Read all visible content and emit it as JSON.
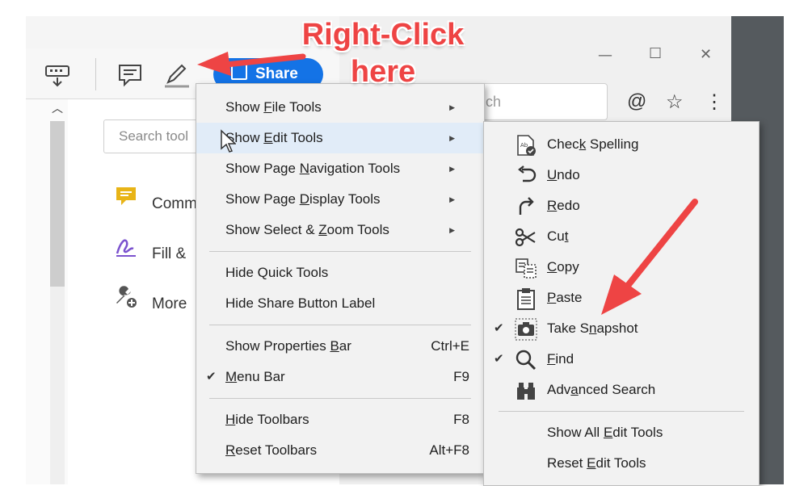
{
  "annotation": {
    "line1": "Right-Click",
    "line2": "here",
    "arrow_color": "#ee4444"
  },
  "share_button": {
    "label": "Share"
  },
  "browser": {
    "window_controls": {
      "minimize": "—",
      "maximize": "☐",
      "close": "✕"
    },
    "address_fragment": "ch",
    "icons": [
      "at-icon",
      "star-icon",
      "more-icon"
    ]
  },
  "tools_pane": {
    "search_placeholder": "Search tool",
    "items": [
      {
        "label": "Comm",
        "icon": "comment-icon",
        "color": "#e8b417"
      },
      {
        "label": "Fill &",
        "icon": "fill-sign-icon",
        "color": "#7b52ce"
      },
      {
        "label": "More",
        "icon": "wrench-plus-icon",
        "color": "#555555"
      }
    ]
  },
  "main_menu": {
    "items": [
      {
        "pre": "Show ",
        "key": "F",
        "post": "ile Tools",
        "submenu": true
      },
      {
        "pre": "Show ",
        "key": "E",
        "post": "dit Tools",
        "submenu": true,
        "highlighted": true
      },
      {
        "pre": "Show Page ",
        "key": "N",
        "post": "avigation Tools",
        "submenu": true
      },
      {
        "pre": "Show Page ",
        "key": "D",
        "post": "isplay Tools",
        "submenu": true
      },
      {
        "pre": "Show Select & ",
        "key": "Z",
        "post": "oom Tools",
        "submenu": true
      },
      {
        "pre": "Hide Quick Tools",
        "key": "",
        "post": ""
      },
      {
        "pre": "Hide Share Button Label",
        "key": "",
        "post": ""
      },
      {
        "pre": "Show Properties ",
        "key": "B",
        "post": "ar",
        "shortcut": "Ctrl+E"
      },
      {
        "pre": "",
        "key": "M",
        "post": "enu Bar",
        "shortcut": "F9",
        "checked": true
      },
      {
        "pre": "",
        "key": "H",
        "post": "ide Toolbars",
        "shortcut": "F8"
      },
      {
        "pre": "",
        "key": "R",
        "post": "eset Toolbars",
        "shortcut": "Alt+F8"
      }
    ]
  },
  "edit_submenu": {
    "items": [
      {
        "pre": "Chec",
        "key": "k",
        "post": " Spelling",
        "icon": "spellcheck-icon"
      },
      {
        "pre": "",
        "key": "U",
        "post": "ndo",
        "icon": "undo-icon"
      },
      {
        "pre": "",
        "key": "R",
        "post": "edo",
        "icon": "redo-icon"
      },
      {
        "pre": "Cu",
        "key": "t",
        "post": "",
        "icon": "scissors-icon"
      },
      {
        "pre": "",
        "key": "C",
        "post": "opy",
        "icon": "copy-icon"
      },
      {
        "pre": "",
        "key": "P",
        "post": "aste",
        "icon": "paste-icon"
      },
      {
        "pre": "Take S",
        "key": "n",
        "post": "apshot",
        "icon": "camera-icon",
        "checked": true
      },
      {
        "pre": "",
        "key": "F",
        "post": "ind",
        "icon": "magnifier-icon",
        "checked": true
      },
      {
        "pre": "Adv",
        "key": "a",
        "post": "nced Search",
        "icon": "binoculars-icon"
      },
      {
        "pre": "Show All ",
        "key": "E",
        "post": "dit Tools"
      },
      {
        "pre": "Reset ",
        "key": "E",
        "post": "dit Tools"
      }
    ]
  },
  "check_mark": "✔",
  "submenu_arrow": "▶"
}
